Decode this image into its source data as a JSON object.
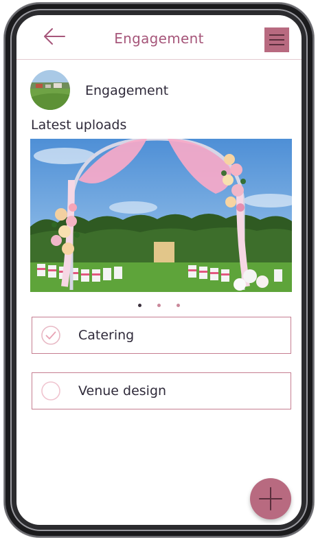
{
  "header": {
    "title": "Engagement",
    "back_icon": "arrow-left-icon",
    "menu_icon": "hamburger-menu-icon"
  },
  "profile": {
    "name": "Engagement",
    "avatar_icon": "landscape-avatar"
  },
  "uploads": {
    "title": "Latest uploads",
    "slides_total": 3,
    "active_slide": 1,
    "image": "wedding-arch-photo"
  },
  "checklist": [
    {
      "label": "Catering",
      "checked": true
    },
    {
      "label": "Venue design",
      "checked": false
    }
  ],
  "fab": {
    "icon": "plus-icon"
  },
  "colors": {
    "accent": "#b86a80",
    "title": "#a6567a",
    "border": "#c57d90",
    "text": "#2f2a3a"
  }
}
